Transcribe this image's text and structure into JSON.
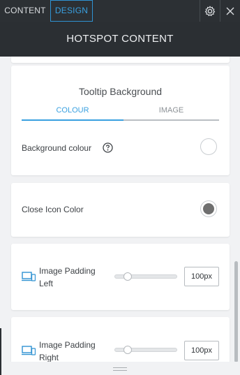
{
  "tabs": {
    "content": "CONTENT",
    "design": "DESIGN"
  },
  "header": {
    "title": "HOTSPOT CONTENT"
  },
  "tooltip_background": {
    "title": "Tooltip Background",
    "tab_colour": "COLOUR",
    "tab_image": "IMAGE",
    "bg_label": "Background colour",
    "bg_color": "#ffffff"
  },
  "close_icon": {
    "label": "Close Icon Color",
    "color": "#6f6f6f"
  },
  "padding_left": {
    "label_line1": "Image Padding",
    "label_line2": "Left",
    "value": "100px"
  },
  "padding_right": {
    "label_line1": "Image Padding",
    "label_line2": "Right",
    "value": "100px"
  },
  "colors": {
    "accent": "#39a0e0",
    "dark_bg": "#2b2f33"
  },
  "icons": [
    "settings-icon",
    "close-icon",
    "help-icon",
    "device-icon",
    "grip-icon"
  ]
}
